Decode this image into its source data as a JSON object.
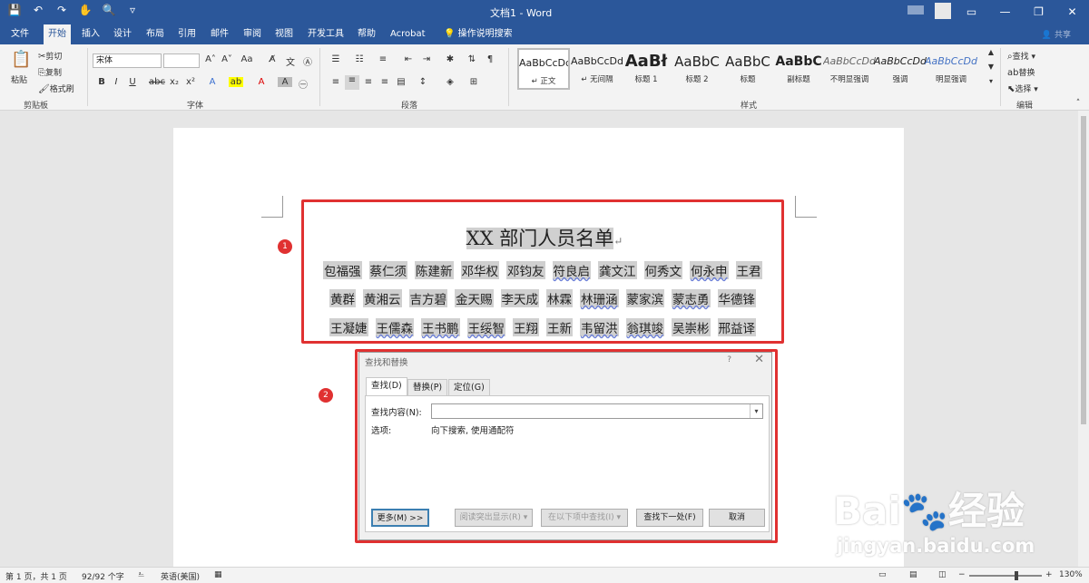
{
  "app": {
    "doc_title": "文档1 - Word",
    "window_buttons": [
      "—",
      "❐",
      "✕"
    ]
  },
  "qat": {
    "save_icon": "save-icon",
    "undo_icon": "undo-icon",
    "redo_icon": "redo-icon"
  },
  "tabs": [
    {
      "label": "文件"
    },
    {
      "label": "开始"
    },
    {
      "label": "插入"
    },
    {
      "label": "设计"
    },
    {
      "label": "布局"
    },
    {
      "label": "引用"
    },
    {
      "label": "邮件"
    },
    {
      "label": "审阅"
    },
    {
      "label": "视图"
    },
    {
      "label": "开发工具"
    },
    {
      "label": "帮助"
    },
    {
      "label": "Acrobat"
    },
    {
      "label": "操作说明搜索"
    }
  ],
  "share_label": "共享",
  "clipboard": {
    "paste": "粘贴",
    "cut": "剪切",
    "copy": "复制",
    "format_painter": "格式刷",
    "group": "剪贴板"
  },
  "font": {
    "name": "宋体",
    "size": "",
    "group": "字体"
  },
  "paragraph": {
    "group": "段落"
  },
  "styles": {
    "group": "样式",
    "items": [
      {
        "preview": "AaBbCcDd",
        "name": "↵ 正文"
      },
      {
        "preview": "AaBbCcDd",
        "name": "↵ 无间隔"
      },
      {
        "preview": "AaBł",
        "name": "标题 1"
      },
      {
        "preview": "AaBbC",
        "name": "标题 2"
      },
      {
        "preview": "AaBbC",
        "name": "标题"
      },
      {
        "preview": "AaBbC",
        "name": "副标题"
      },
      {
        "preview": "AaBbCcDd",
        "name": "不明显强调"
      },
      {
        "preview": "AaBbCcDd",
        "name": "强调"
      },
      {
        "preview": "AaBbCcDd",
        "name": "明显强调"
      }
    ]
  },
  "editing": {
    "find": "查找",
    "replace": "替换",
    "select": "选择",
    "group": "编辑"
  },
  "document": {
    "heading": "XX 部门人员名单",
    "rows": [
      [
        "包福强",
        "蔡仁须",
        "陈建新",
        "邓华权",
        "邓钧友",
        "符良启",
        "龚文江",
        "何秀文",
        "何永申",
        "王君"
      ],
      [
        "黄群",
        "黄湘云",
        "吉方碧",
        "金天赐",
        "李天成",
        "林霖",
        "林珊涵",
        "蒙家滨",
        "蒙志勇",
        "华德锋"
      ],
      [
        "王凝婕",
        "王儒森",
        "王书鹏",
        "王绥智",
        "王翔",
        "王新",
        "韦留洪",
        "翁琪竣",
        "吴崇彬",
        "邢益译"
      ]
    ],
    "para_mark": "↵"
  },
  "badges": [
    "1",
    "2"
  ],
  "dialog": {
    "title": "查找和替换",
    "help": "?",
    "tabs": [
      "查找(D)",
      "替换(P)",
      "定位(G)"
    ],
    "find_label": "查找内容(N):",
    "find_value": "",
    "options_label": "选项:",
    "options_value": "向下搜索, 使用通配符",
    "buttons": {
      "more": "更多(M) >>",
      "reading_highlight": "阅读突出显示(R) ▾",
      "find_in": "在以下项中查找(I) ▾",
      "find_next": "查找下一处(F)",
      "cancel": "取消"
    }
  },
  "status": {
    "page": "第 1 页，共 1 页",
    "words": "92/92 个字",
    "language": "英语(美国)",
    "zoom": "130%"
  },
  "watermark": {
    "main": "Bai🐾经验",
    "sub": "jingyan.baidu.com"
  }
}
